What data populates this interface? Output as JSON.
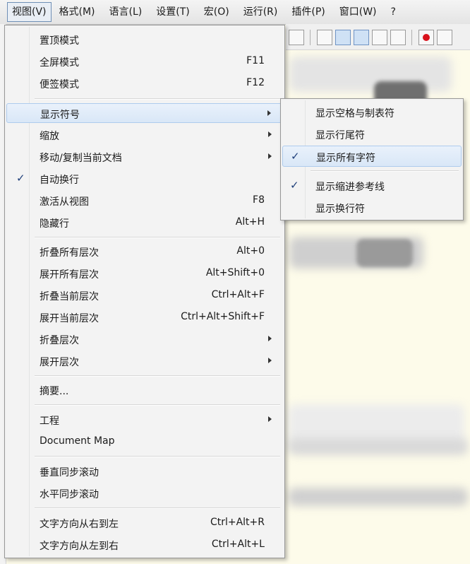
{
  "menubar": {
    "items": [
      "视图(V)",
      "格式(M)",
      "语言(L)",
      "设置(T)",
      "宏(O)",
      "运行(R)",
      "插件(P)",
      "窗口(W)",
      "?"
    ]
  },
  "view_menu": {
    "items": [
      {
        "label": "置顶模式",
        "shortcut": ""
      },
      {
        "label": "全屏模式",
        "shortcut": "F11"
      },
      {
        "label": "便签模式",
        "shortcut": "F12"
      },
      {
        "label": "显示符号",
        "submenu": true
      },
      {
        "label": "缩放",
        "submenu": true
      },
      {
        "label": "移动/复制当前文档",
        "submenu": true
      },
      {
        "label": "自动换行",
        "checked": true
      },
      {
        "label": "激活从视图",
        "shortcut": "F8"
      },
      {
        "label": "隐藏行",
        "shortcut": "Alt+H"
      },
      {
        "label": "折叠所有层次",
        "shortcut": "Alt+0"
      },
      {
        "label": "展开所有层次",
        "shortcut": "Alt+Shift+0"
      },
      {
        "label": "折叠当前层次",
        "shortcut": "Ctrl+Alt+F"
      },
      {
        "label": "展开当前层次",
        "shortcut": "Ctrl+Alt+Shift+F"
      },
      {
        "label": "折叠层次",
        "submenu": true
      },
      {
        "label": "展开层次",
        "submenu": true
      },
      {
        "label": "摘要..."
      },
      {
        "label": "工程",
        "submenu": true
      },
      {
        "label": "Document Map"
      },
      {
        "label": "垂直同步滚动"
      },
      {
        "label": "水平同步滚动"
      },
      {
        "label": "文字方向从右到左",
        "shortcut": "Ctrl+Alt+R"
      },
      {
        "label": "文字方向从左到右",
        "shortcut": "Ctrl+Alt+L"
      }
    ]
  },
  "symbols_submenu": {
    "items": [
      {
        "label": "显示空格与制表符",
        "checked": false
      },
      {
        "label": "显示行尾符",
        "checked": false
      },
      {
        "label": "显示所有字符",
        "checked": true
      },
      {
        "label": "显示缩进参考线",
        "checked": true
      },
      {
        "label": "显示换行符",
        "checked": false
      }
    ]
  },
  "check_mark": "✓",
  "colors": {
    "highlight_border": "#aecbed",
    "highlight_fill": "#dde9f7",
    "check": "#1f3f7a"
  }
}
